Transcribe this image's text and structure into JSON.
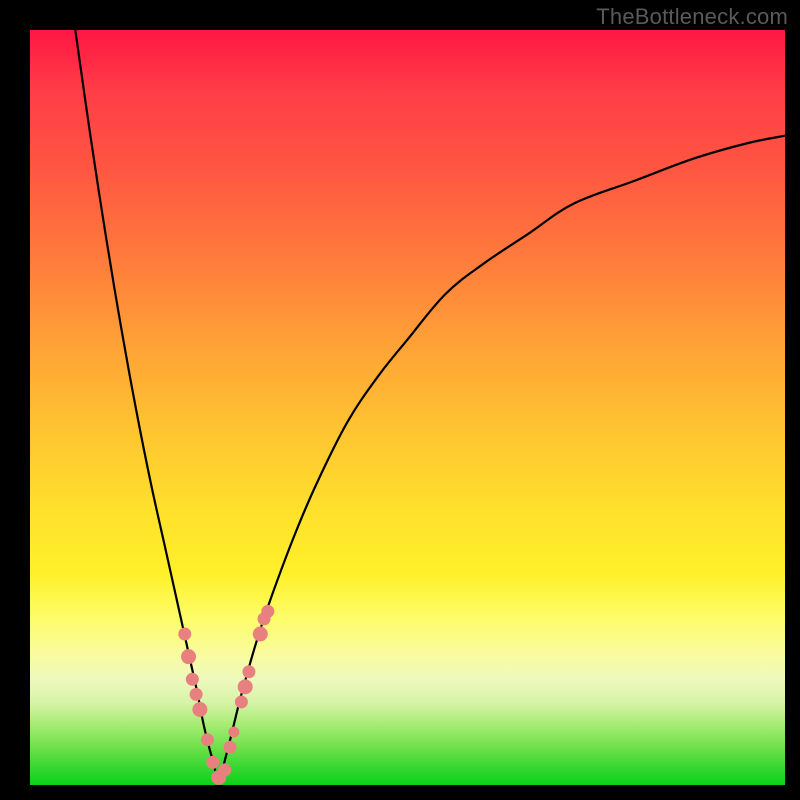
{
  "watermark": "TheBottleneck.com",
  "colors": {
    "curve_stroke": "#000000",
    "marker_fill": "#e98080",
    "marker_stroke": "#e98080"
  },
  "chart_data": {
    "type": "line",
    "title": "",
    "xlabel": "",
    "ylabel": "",
    "xlim": [
      0,
      100
    ],
    "ylim": [
      0,
      100
    ],
    "curve": {
      "left_x_top": 6,
      "min_x": 25,
      "right_x_top": 100,
      "right_y_at_xmax": 86,
      "x": [
        6,
        8,
        10,
        12,
        14,
        16,
        18,
        20,
        22,
        23,
        24,
        25,
        26,
        27,
        28,
        30,
        32,
        35,
        38,
        42,
        46,
        50,
        55,
        60,
        66,
        72,
        80,
        88,
        95,
        100
      ],
      "y": [
        100,
        86,
        73,
        61,
        50,
        40,
        31,
        22,
        13,
        8,
        4,
        1,
        4,
        8,
        12,
        19,
        25,
        33,
        40,
        48,
        54,
        59,
        65,
        69,
        73,
        77,
        80,
        83,
        85,
        86
      ]
    },
    "markers": [
      {
        "x": 20.5,
        "y": 20,
        "r": 6
      },
      {
        "x": 21.0,
        "y": 17,
        "r": 7
      },
      {
        "x": 21.5,
        "y": 14,
        "r": 6
      },
      {
        "x": 22.0,
        "y": 12,
        "r": 6
      },
      {
        "x": 22.5,
        "y": 10,
        "r": 7
      },
      {
        "x": 23.5,
        "y": 6,
        "r": 6
      },
      {
        "x": 24.2,
        "y": 3,
        "r": 6
      },
      {
        "x": 25.0,
        "y": 1,
        "r": 7
      },
      {
        "x": 25.8,
        "y": 2,
        "r": 6
      },
      {
        "x": 26.5,
        "y": 5,
        "r": 6
      },
      {
        "x": 27.0,
        "y": 7,
        "r": 5
      },
      {
        "x": 28.0,
        "y": 11,
        "r": 6
      },
      {
        "x": 28.5,
        "y": 13,
        "r": 7
      },
      {
        "x": 29.0,
        "y": 15,
        "r": 6
      },
      {
        "x": 30.5,
        "y": 20,
        "r": 7
      },
      {
        "x": 31.0,
        "y": 22,
        "r": 6
      },
      {
        "x": 31.5,
        "y": 23,
        "r": 6
      }
    ]
  }
}
